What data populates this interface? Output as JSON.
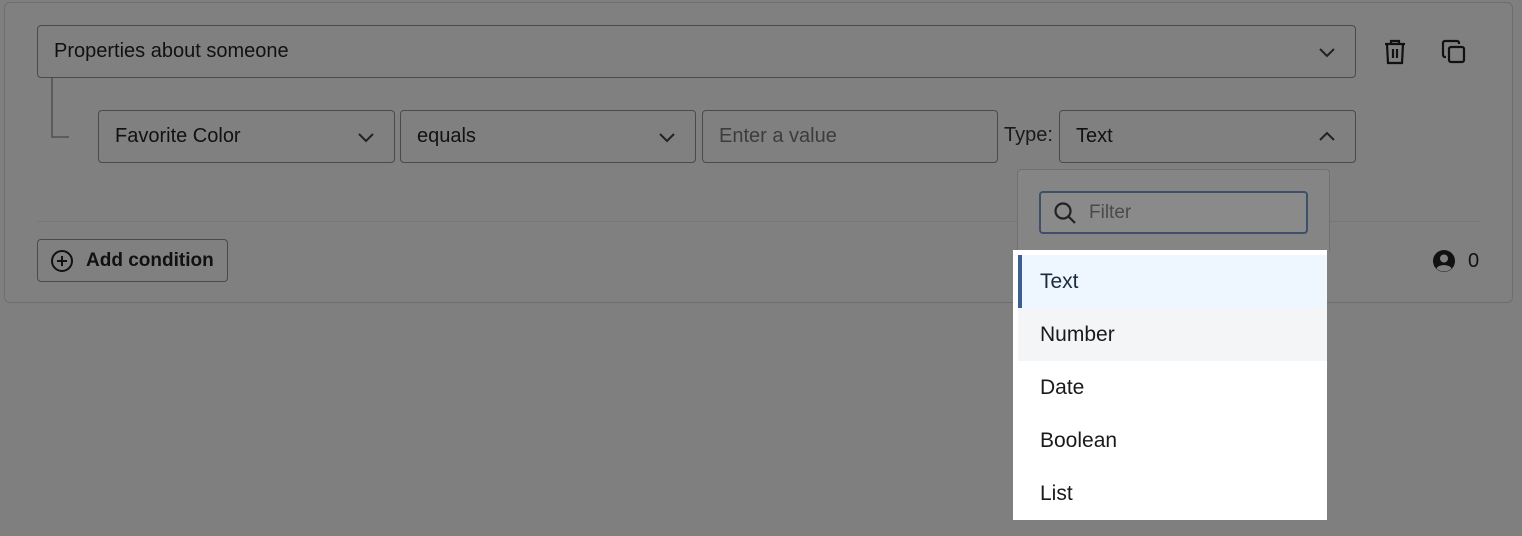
{
  "group": {
    "selected": "Properties about someone",
    "icon": "chevron-down-icon"
  },
  "actions": {
    "delete_icon": "trash-icon",
    "duplicate_icon": "copy-icon"
  },
  "condition": {
    "field": "Favorite Color",
    "operator": "equals",
    "value_placeholder": "Enter a value",
    "type_label": "Type:",
    "type": "Text"
  },
  "add_condition_label": "Add condition",
  "audience_count": "0",
  "dropdown": {
    "filter_placeholder": "Filter",
    "options": [
      "Text",
      "Number",
      "Date",
      "Boolean",
      "List"
    ],
    "selected": "Text",
    "hovered": "Number"
  },
  "colors": {
    "selected_accent": "#3b5f92",
    "selected_bg": "#eef6ff"
  }
}
